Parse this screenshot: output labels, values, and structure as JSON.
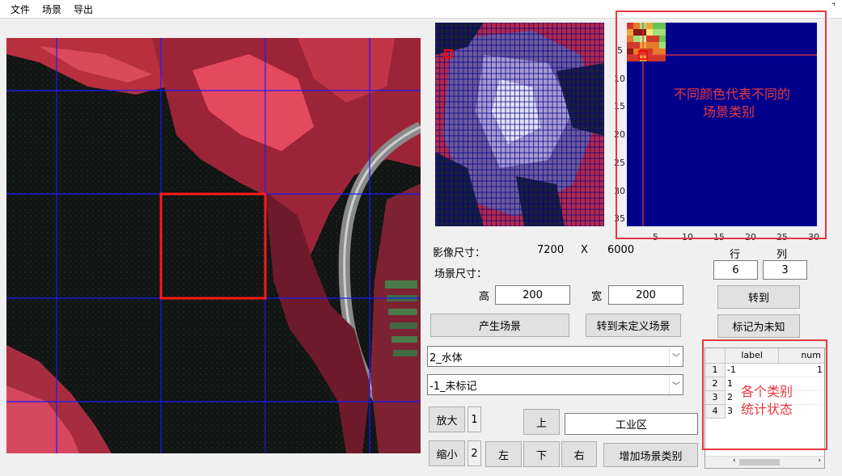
{
  "menu": {
    "file": "文件",
    "scene": "场景",
    "export": "导出"
  },
  "info": {
    "image_size_label": "影像尺寸：",
    "image_width": "7200",
    "x_sep": "X",
    "image_height": "6000",
    "scene_size_label": "场景尺寸：",
    "height_label": "高",
    "height_value": "200",
    "width_label": "宽",
    "width_value": "200"
  },
  "nav": {
    "row_label": "行",
    "col_label": "列",
    "row_value": "6",
    "col_value": "3",
    "goto": "转到",
    "mark_unknown": "标记为未知"
  },
  "actions": {
    "generate": "产生场景",
    "goto_undefined": "转到未定义场景"
  },
  "combos": {
    "class_selected": "2_水体",
    "status_selected": "-1_未标记"
  },
  "controls": {
    "zoom_in": "放大",
    "zoom_in_level": "1",
    "zoom_out": "缩小",
    "zoom_out_level": "2",
    "up": "上",
    "left": "左",
    "down": "下",
    "right": "右",
    "new_class_name": "工业区",
    "add_class": "增加场景类别"
  },
  "label_map": {
    "y_ticks": [
      "5",
      "10",
      "15",
      "20",
      "25",
      "30",
      "35"
    ],
    "x_ticks": [
      "5",
      "10",
      "15",
      "20",
      "25",
      "30"
    ],
    "annotation_line1": "不同颜色代表不同的",
    "annotation_line2": "场景类别"
  },
  "stats_table": {
    "headers": [
      "label",
      "num"
    ],
    "rows": [
      {
        "idx": "1",
        "label": "-1",
        "num": "1"
      },
      {
        "idx": "2",
        "label": "1",
        "num": ""
      },
      {
        "idx": "3",
        "label": "2",
        "num": ""
      },
      {
        "idx": "4",
        "label": "3",
        "num": ""
      }
    ],
    "annotation_line1": "各个类别",
    "annotation_line2": "统计状态"
  },
  "colors": {
    "accent_red": "#e8383d",
    "map_background": "#00008b",
    "grid_blue": "#1a1aff"
  }
}
